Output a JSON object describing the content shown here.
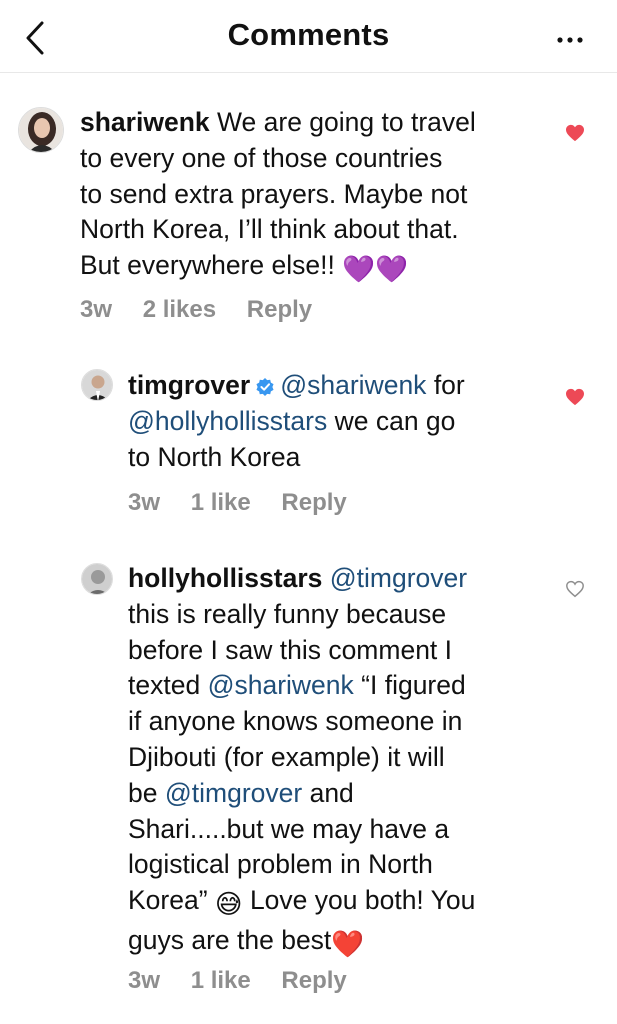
{
  "header": {
    "title": "Comments",
    "more_icon": "more-horizontal-icon",
    "back_icon": "chevron-left-icon"
  },
  "comments": [
    {
      "username": "shariwenk",
      "text_line1": "We are going to travel",
      "text_line2": "to every one of those countries",
      "text_line3": "to send extra prayers. Maybe not",
      "text_line4": "North Korea, I’ll think about that.",
      "text_line5": "But everywhere else!!",
      "emoji": "💜💜",
      "time": "3w",
      "likes": "2 likes",
      "reply": "Reply",
      "liked": true
    },
    {
      "username": "timgrover",
      "verified": true,
      "mention1": "@shariwenk",
      "text_a": "for",
      "mention2": "@hollyhollisstars",
      "text_b": "we can go",
      "text_c": "to North Korea",
      "time": "3w",
      "likes": "1 like",
      "reply": "Reply",
      "liked": true
    },
    {
      "username": "hollyhollisstars",
      "mention1": "@timgrover",
      "line2": "this is really funny because",
      "line3": "before I saw this comment I",
      "line4_a": "texted",
      "mention2": "@shariwenk",
      "line4_b": "“I figured",
      "line5": "if anyone knows someone in",
      "line6": "Djibouti (for example) it will",
      "line7_a": "be",
      "mention3": "@timgrover",
      "line7_b": "and",
      "line8": "Shari.....but we may have a",
      "line9": "logistical problem in North",
      "line10_a": "Korea”",
      "emoji1": "😅",
      "line10_b": "Love you both! You",
      "line11": "guys are the best",
      "emoji2": "❤️",
      "time": "3w",
      "likes": "1 like",
      "reply": "Reply",
      "liked": false
    }
  ],
  "colors": {
    "heart_red": "#ed4956",
    "mention_blue": "#1f4e79",
    "meta_gray": "#8e8e8e",
    "verified_blue": "#3897f0"
  }
}
